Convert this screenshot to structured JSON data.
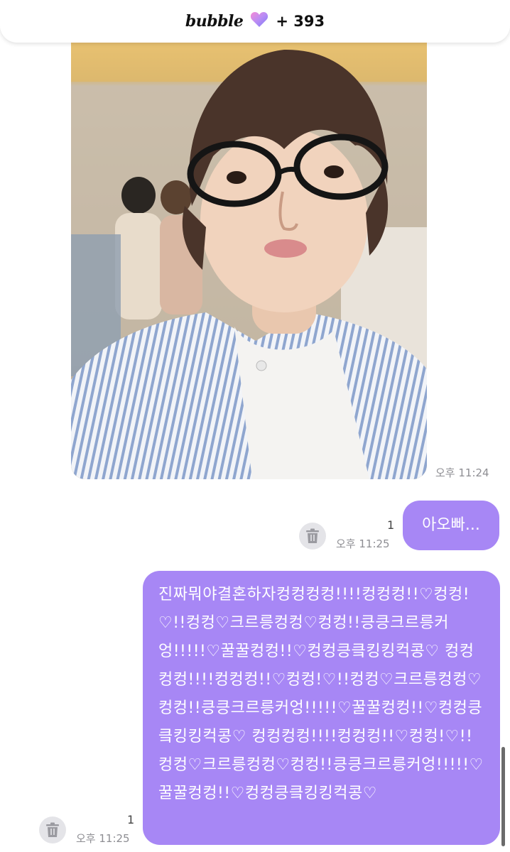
{
  "header": {
    "brand": "bubble",
    "count_text": "+ 393",
    "heart_icon": "gradient-heart-icon"
  },
  "messages": [
    {
      "type": "photo",
      "time": "오후 11:24"
    },
    {
      "type": "text",
      "read_count": "1",
      "time": "오후 11:25",
      "text": "아오빠..."
    },
    {
      "type": "text",
      "read_count": "1",
      "time": "오후 11:25",
      "text": "진짜뭐야결혼하자컹컹컹컹!!!!컹컹컹!!♡컹컹!♡!!컹컹♡크르릉컹컹♡컹컹!!킁킁크르릉커엉!!!!!♡꿀꿀컹컹!!♡컹컹킁킄킹킹컥콩♡ 컹컹컹컹!!!!컹컹컹!!♡컹컹!♡!!컹컹♡크르릉컹컹♡컹컹!!킁킁크르릉커엉!!!!!♡꿀꿀컹컹!!♡컹컹킁킄킹킹컥콩♡ 컹컹컹컹!!!!컹컹컹!!♡컹컹!♡!!컹컹♡크르릉컹컹♡컹컹!!킁킁크르릉커엉!!!!!♡꿀꿀컹컹!!♡컹컹킁킄킹킹컥콩♡"
    }
  ],
  "colors": {
    "bubble": "#a787f5",
    "timestamp": "#8e8e93"
  }
}
